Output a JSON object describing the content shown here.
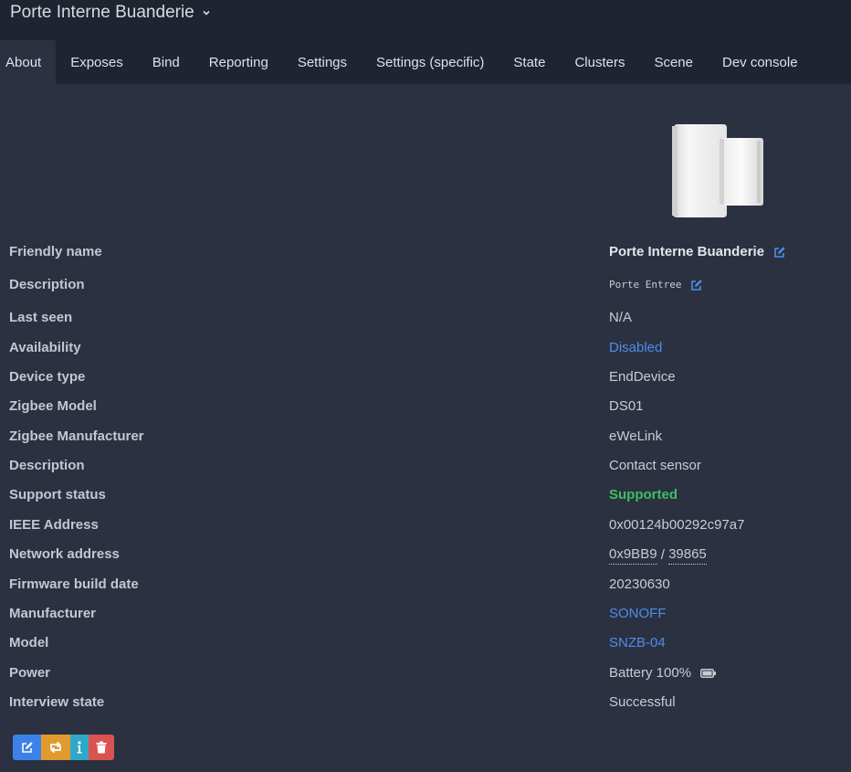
{
  "header": {
    "device_title": "Porte Interne Buanderie"
  },
  "tabs": [
    {
      "label": "About"
    },
    {
      "label": "Exposes"
    },
    {
      "label": "Bind"
    },
    {
      "label": "Reporting"
    },
    {
      "label": "Settings"
    },
    {
      "label": "Settings (specific)"
    },
    {
      "label": "State"
    },
    {
      "label": "Clusters"
    },
    {
      "label": "Scene"
    },
    {
      "label": "Dev console"
    }
  ],
  "active_tab": "About",
  "about": {
    "friendly_name": {
      "label": "Friendly name",
      "value": "Porte Interne Buanderie"
    },
    "description_user": {
      "label": "Description",
      "value": "Porte Entree"
    },
    "last_seen": {
      "label": "Last seen",
      "value": "N/A"
    },
    "availability": {
      "label": "Availability",
      "value": "Disabled"
    },
    "device_type": {
      "label": "Device type",
      "value": "EndDevice"
    },
    "zigbee_model": {
      "label": "Zigbee Model",
      "value": "DS01"
    },
    "zigbee_manufacturer": {
      "label": "Zigbee Manufacturer",
      "value": "eWeLink"
    },
    "description": {
      "label": "Description",
      "value": "Contact sensor"
    },
    "support_status": {
      "label": "Support status",
      "value": "Supported"
    },
    "ieee_address": {
      "label": "IEEE Address",
      "value": "0x00124b00292c97a7"
    },
    "network_address": {
      "label": "Network address",
      "hex": "0x9BB9",
      "sep": " / ",
      "dec": "39865"
    },
    "firmware_build_date": {
      "label": "Firmware build date",
      "value": "20230630"
    },
    "manufacturer": {
      "label": "Manufacturer",
      "value": "SONOFF"
    },
    "model": {
      "label": "Model",
      "value": "SNZB-04"
    },
    "power": {
      "label": "Power",
      "value": "Battery 100%",
      "icon": "battery-full-icon"
    },
    "interview_state": {
      "label": "Interview state",
      "value": "Successful"
    }
  },
  "colors": {
    "link": "#4d8ee8",
    "supported": "#3fbf5f",
    "edit_button": "#3b82e8",
    "reconfigure_button": "#e09a2e",
    "info_button": "#2da8c9",
    "delete_button": "#d9534f"
  },
  "actions": [
    {
      "icon": "edit-icon"
    },
    {
      "icon": "swap-icon"
    },
    {
      "icon": "info-icon"
    },
    {
      "icon": "trash-icon"
    }
  ]
}
